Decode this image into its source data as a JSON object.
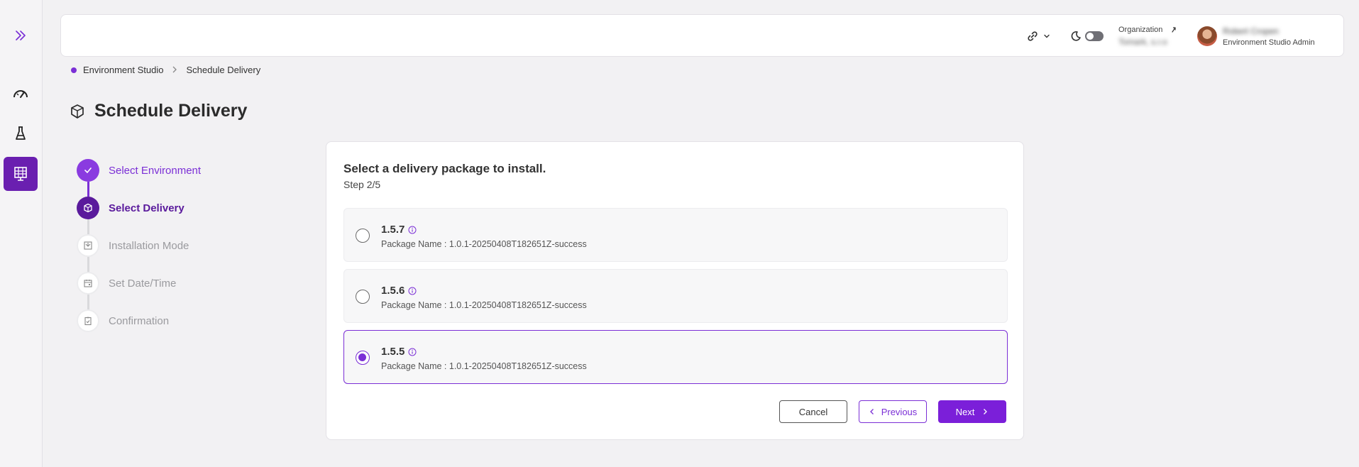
{
  "rail": {
    "expand_icon": "chevron-double-right-icon",
    "items": [
      {
        "icon": "speedometer-icon"
      },
      {
        "icon": "flask-icon"
      },
      {
        "icon": "grid-monitor-icon",
        "active": true
      }
    ]
  },
  "header": {
    "link_icon": "link-icon",
    "theme_icon": "moon-icon",
    "organization_label": "Organization",
    "organization_name": "Tomark, s.r.o",
    "user_name": "Robert Cropen",
    "user_role": "Environment Studio Admin"
  },
  "breadcrumb": {
    "items": [
      "Environment Studio",
      "Schedule Delivery"
    ]
  },
  "page": {
    "title": "Schedule Delivery"
  },
  "stepper": {
    "steps": [
      {
        "label": "Select Environment",
        "state": "done"
      },
      {
        "label": "Select Delivery",
        "state": "active"
      },
      {
        "label": "Installation Mode",
        "state": "pending"
      },
      {
        "label": "Set Date/Time",
        "state": "pending"
      },
      {
        "label": "Confirmation",
        "state": "pending"
      }
    ]
  },
  "card": {
    "title": "Select a delivery package to install.",
    "step": "Step 2/5",
    "options": [
      {
        "version": "1.5.7",
        "package": "Package Name : 1.0.1-20250408T182651Z-success",
        "selected": false
      },
      {
        "version": "1.5.6",
        "package": "Package Name : 1.0.1-20250408T182651Z-success",
        "selected": false
      },
      {
        "version": "1.5.5",
        "package": "Package Name : 1.0.1-20250408T182651Z-success",
        "selected": true
      }
    ],
    "buttons": {
      "cancel": "Cancel",
      "previous": "Previous",
      "next": "Next"
    }
  },
  "colors": {
    "accent": "#7b2fd6",
    "accent_dark": "#6a1fb0",
    "step_pending": "#d9d9dc"
  }
}
